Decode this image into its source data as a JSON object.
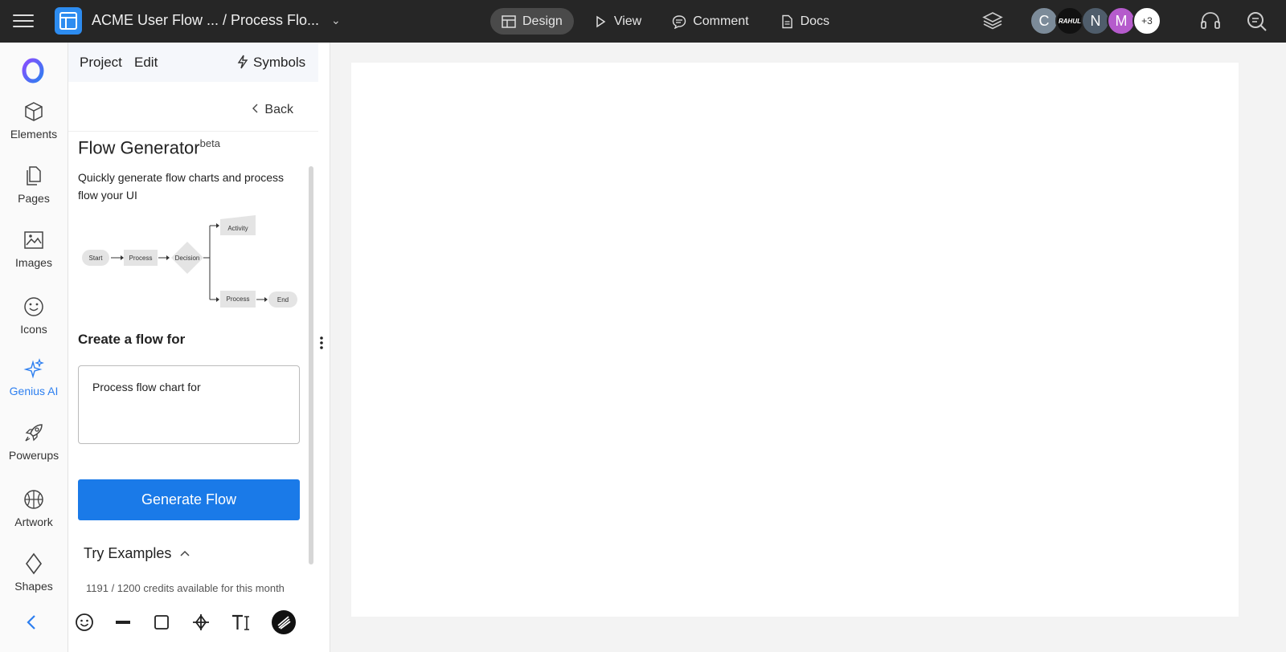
{
  "topbar": {
    "doc_title": "ACME User Flow ... / Process Flo...",
    "modes": [
      {
        "label": "Design",
        "icon": "layout-icon",
        "active": true
      },
      {
        "label": "View",
        "icon": "play-icon",
        "active": false
      },
      {
        "label": "Comment",
        "icon": "comment-icon",
        "active": false
      },
      {
        "label": "Docs",
        "icon": "doc-icon",
        "active": false
      }
    ],
    "avatars": [
      {
        "initial": "C",
        "color": "#7c8b99"
      },
      {
        "initial": "RAHUL",
        "color": "#111111"
      },
      {
        "initial": "N",
        "color": "#4f5d6b"
      },
      {
        "initial": "M",
        "color": "#b55bcc"
      }
    ],
    "more_count": "+3"
  },
  "rail": {
    "items": [
      {
        "label": "Elements",
        "icon": "cube-icon"
      },
      {
        "label": "Pages",
        "icon": "pages-icon"
      },
      {
        "label": "Images",
        "icon": "image-icon"
      },
      {
        "label": "Icons",
        "icon": "smiley-icon"
      },
      {
        "label": "Genius AI",
        "icon": "sparkle-icon",
        "active": true
      },
      {
        "label": "Powerups",
        "icon": "rocket-icon"
      },
      {
        "label": "Artwork",
        "icon": "basketball-icon"
      },
      {
        "label": "Shapes",
        "icon": "diamond-icon"
      }
    ]
  },
  "panel": {
    "menu": {
      "project": "Project",
      "edit": "Edit",
      "symbols": "Symbols"
    },
    "back": "Back",
    "title": "Flow Generator",
    "title_badge": "beta",
    "description": "Quickly generate flow charts and process flow your UI",
    "diagram": {
      "start": "Start",
      "process1": "Process",
      "decision": "Decision",
      "activity": "Activity",
      "process2": "Process",
      "end": "End"
    },
    "section_label": "Create a flow for",
    "prompt_value": "Process flow chart for ",
    "generate_button": "Generate Flow",
    "try_examples": "Try Examples",
    "credits": "1191 / 1200 credits available for this month"
  },
  "colors": {
    "accent": "#1a7ae8",
    "topbar": "#262626"
  }
}
